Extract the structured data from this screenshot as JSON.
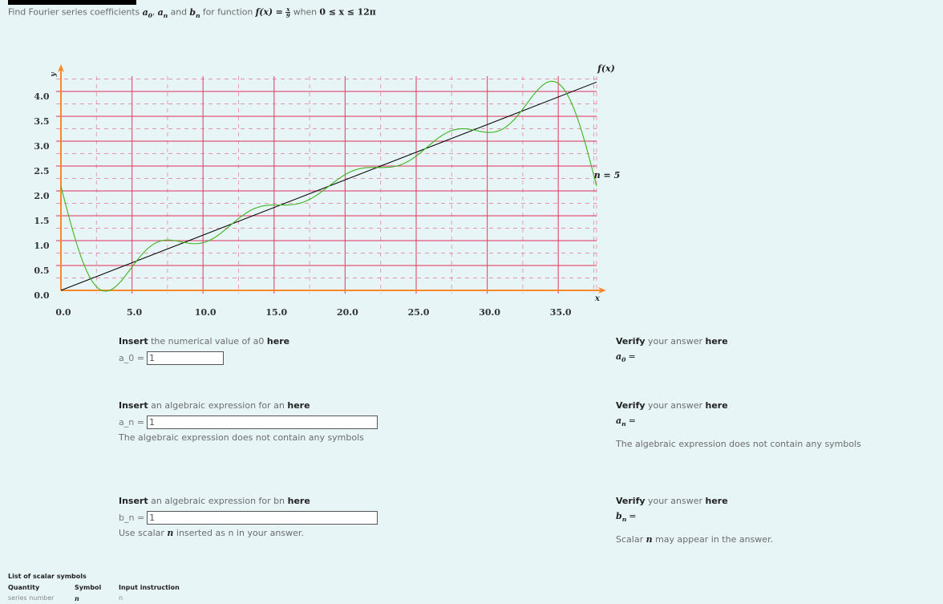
{
  "title": {
    "prefix": "Find Fourier series coefficients",
    "a0": "a",
    "a0_sub": "0",
    "an": "a",
    "an_sub": "n",
    "and": "and",
    "bn": "b",
    "bn_sub": "n",
    "for_function": "for function",
    "f_lhs": "f(x) =",
    "frac_num": "x",
    "frac_den": "9",
    "when": "when",
    "domain": "0 ≤ x ≤ 12π"
  },
  "chart_data": {
    "type": "line",
    "title": "",
    "xlabel": "x",
    "ylabel": "y",
    "xlim": [
      0,
      37.699
    ],
    "ylim": [
      0,
      4.19
    ],
    "x_ticks": [
      0,
      5,
      10,
      15,
      20,
      25,
      30,
      35
    ],
    "x_tick_labels": [
      "0.0",
      "5.0",
      "10.0",
      "15.0",
      "20.0",
      "25.0",
      "30.0",
      "35.0"
    ],
    "y_ticks": [
      0,
      0.5,
      1.0,
      1.5,
      2.0,
      2.5,
      3.0,
      3.5,
      4.0
    ],
    "y_tick_labels": [
      "0.0",
      "0.5",
      "1.0",
      "1.5",
      "2.0",
      "2.5",
      "3.0",
      "3.5",
      "4.0"
    ],
    "grid": true,
    "series": [
      {
        "name": "f(x)",
        "label": "f(x)",
        "expression": "x/9",
        "color": "#000000",
        "label_position": "top-right"
      },
      {
        "name": "n = 5",
        "label": "n = 5",
        "expression": "2.0944 - sum_{n=1..5} (4/(3n)) sin(n x / 6)",
        "color": "#3cb521",
        "label_position": "right"
      }
    ],
    "axis_color": "#f7892a",
    "grid_color": "#e0476b"
  },
  "a0_block": {
    "head_bold1": "Insert",
    "head_text": " the numerical value of a0 ",
    "head_bold2": "here",
    "label": "a_0 =",
    "value": "1"
  },
  "an_block": {
    "head_bold1": "Insert",
    "head_text": " an algebraic expression for an ",
    "head_bold2": "here",
    "label": "a_n =",
    "value": "1",
    "note": "The algebraic expression does not contain any symbols"
  },
  "bn_block": {
    "head_bold1": "Insert",
    "head_text": " an algebraic expression for bn ",
    "head_bold2": "here",
    "label": "b_n =",
    "value": "1",
    "note_pre": "Use scalar ",
    "note_sym": "n",
    "note_post": " inserted as n in your answer."
  },
  "verify_a0": {
    "head_bold1": "Verify",
    "head_text": " your answer ",
    "head_bold2": "here",
    "sym": "a",
    "sub": "0",
    "eq": "="
  },
  "verify_an": {
    "head_bold1": "Verify",
    "head_text": " your answer ",
    "head_bold2": "here",
    "sym": "a",
    "sub": "n",
    "eq": "=",
    "note": "The algebraic expression does not contain any symbols"
  },
  "verify_bn": {
    "head_bold1": "Verify",
    "head_text": " your answer ",
    "head_bold2": "here",
    "sym": "b",
    "sub": "n",
    "eq": "=",
    "note_pre": "Scalar ",
    "note_sym": "n",
    "note_post": " may appear in the answer."
  },
  "symbols": {
    "caption": "List of scalar symbols",
    "headers": [
      "Quantity",
      "Symbol",
      "Input instruction"
    ],
    "rows": [
      [
        "series number",
        "n",
        "n"
      ]
    ]
  }
}
